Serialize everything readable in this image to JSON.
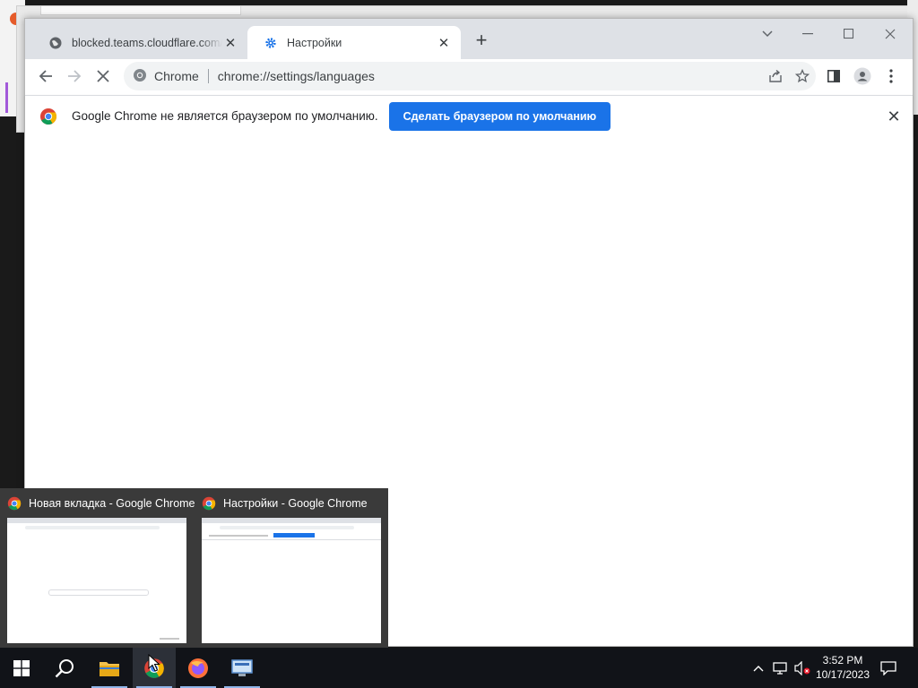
{
  "browser": {
    "tabs": [
      {
        "title": "blocked.teams.cloudflare.com/?bi",
        "active": false,
        "icon": "globe-icon"
      },
      {
        "title": "Настройки",
        "active": true,
        "icon": "settings-gear-icon"
      }
    ],
    "omnibox": {
      "chip_label": "Chrome",
      "url": "chrome://settings/languages"
    },
    "infobar": {
      "message": "Google Chrome не является браузером по умолчанию.",
      "button_label": "Сделать браузером по умолчанию"
    }
  },
  "taskbar_previews": [
    {
      "title": "Новая вкладка - Google Chrome"
    },
    {
      "title": "Настройки - Google Chrome"
    }
  ],
  "clock": {
    "time": "3:52 PM",
    "date": "10/17/2023"
  },
  "colors": {
    "accent_blue": "#1a73e8",
    "tabstrip": "#dee1e6",
    "taskbar": "#111318"
  }
}
